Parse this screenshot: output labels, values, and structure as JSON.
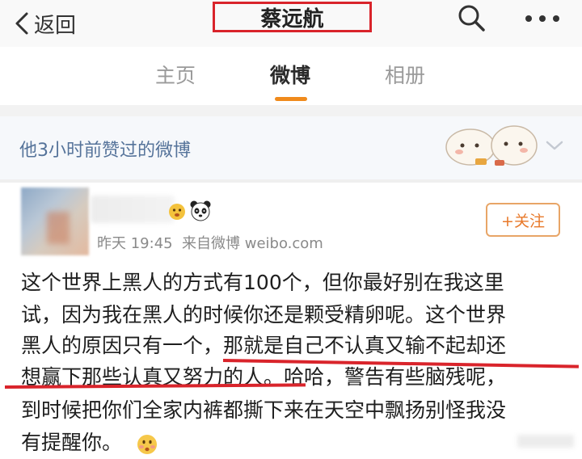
{
  "nav": {
    "back_label": "返回",
    "title": "蔡远航",
    "icons": [
      "back-arrow-icon",
      "search-icon",
      "more-icon"
    ]
  },
  "tabs": [
    {
      "label": "主页",
      "active": false
    },
    {
      "label": "微博",
      "active": true
    },
    {
      "label": "相册",
      "active": false
    }
  ],
  "liked_bar": {
    "text": "他3小时前赞过的微博"
  },
  "post": {
    "meta": "昨天 19:45  来自微博 weibo.com",
    "follow_label": "+关注",
    "lines": [
      "这个世界上黑人的方式有100个，但你最好别在我这里",
      "试，因为我在黑人的时候你还是颗受精卵呢。这个世界",
      "黑人的原因只有一个，那就是自己不认真又输不起却还",
      "想赢下那些认真又努力的人。哈哈，警告有些脑残呢，",
      "到时候把你们全家内裤都撕下来在天空中飘扬别怪我没",
      "有提醒你。"
    ]
  },
  "colors": {
    "highlight_red": "#d9242b",
    "tab_accent": "#f08a1c",
    "link_blue": "#55739a",
    "follow_orange": "#e8792a"
  }
}
